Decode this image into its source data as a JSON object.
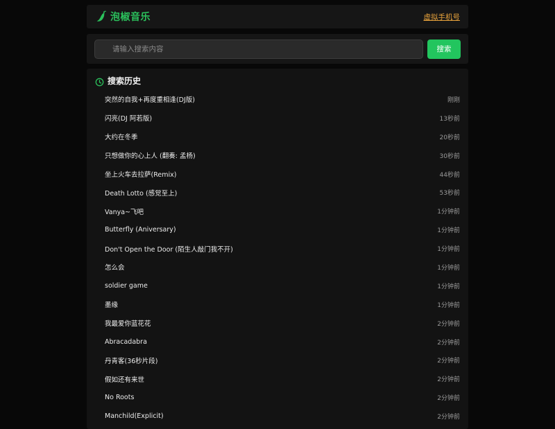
{
  "header": {
    "brand_title": "泡椒音乐",
    "virtual_phone_link": "虚拟手机号",
    "logo_icon": "chili-pepper-icon",
    "brand_color": "#2bc15c",
    "link_color": "#e8a33c"
  },
  "search": {
    "placeholder": "请输入搜索内容",
    "value": "",
    "button_label": "搜索",
    "button_color": "#22c55e"
  },
  "history": {
    "title": "搜索历史",
    "title_icon": "clock-icon",
    "items": [
      {
        "title": "突然的自我+再度重相逢(DJ版)",
        "time": "刚刚"
      },
      {
        "title": "闪亮(DJ 阿若版)",
        "time": "13秒前"
      },
      {
        "title": "大约在冬季",
        "time": "20秒前"
      },
      {
        "title": "只想做你的心上人 (翻奏: 孟杨)",
        "time": "30秒前"
      },
      {
        "title": "坐上火车去拉萨(Remix)",
        "time": "44秒前"
      },
      {
        "title": "Death Lotto (感觉至上)",
        "time": "53秒前"
      },
      {
        "title": "Vanya~飞吧",
        "time": "1分钟前"
      },
      {
        "title": "Butterfly (Aniversary)",
        "time": "1分钟前"
      },
      {
        "title": "Don't Open the Door (陌生人敲门我不开)",
        "time": "1分钟前"
      },
      {
        "title": "怎么会",
        "time": "1分钟前"
      },
      {
        "title": "soldier game",
        "time": "1分钟前"
      },
      {
        "title": "墨缘",
        "time": "1分钟前"
      },
      {
        "title": "我最爱你蓝花花",
        "time": "2分钟前"
      },
      {
        "title": "Abracadabra",
        "time": "2分钟前"
      },
      {
        "title": "丹青客(36秒片段)",
        "time": "2分钟前"
      },
      {
        "title": "假如还有来世",
        "time": "2分钟前"
      },
      {
        "title": "No Roots",
        "time": "2分钟前"
      },
      {
        "title": "Manchild(Explicit)",
        "time": "2分钟前"
      }
    ]
  }
}
